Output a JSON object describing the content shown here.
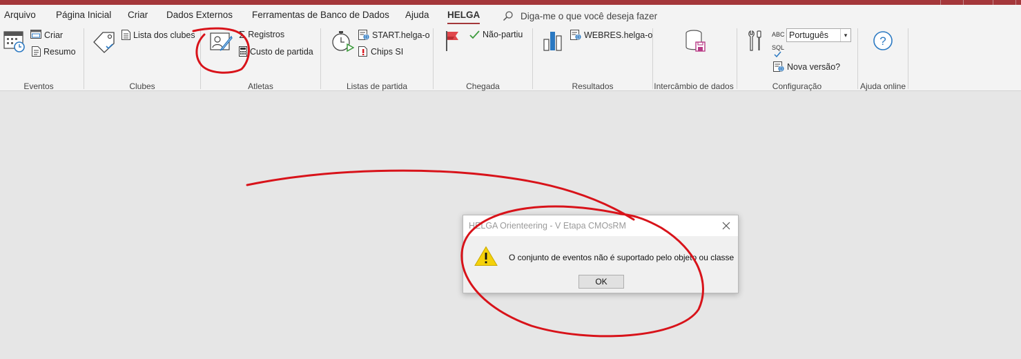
{
  "tabs": {
    "items": [
      "Arquivo",
      "Página Inicial",
      "Criar",
      "Dados Externos",
      "Ferramentas de Banco de Dados",
      "Ajuda",
      "HELGA"
    ],
    "active": "HELGA",
    "tell_me": "Diga-me o que você deseja fazer"
  },
  "ribbon": {
    "eventos": {
      "label": "Eventos",
      "criar": "Criar",
      "resumo": "Resumo"
    },
    "clubes": {
      "label": "Clubes",
      "lista": "Lista dos clubes"
    },
    "atletas": {
      "label": "Atletas",
      "registros": "Registros",
      "custo": "Custo de partida"
    },
    "listas": {
      "label": "Listas de partida",
      "start": "START.helga-o",
      "chips": "Chips SI"
    },
    "chegada": {
      "label": "Chegada",
      "nao_partiu": "Não-partiu"
    },
    "resultados": {
      "label": "Resultados",
      "webres": "WEBRES.helga-o"
    },
    "intercambio": {
      "label": "Intercâmbio de dados"
    },
    "configuracao": {
      "label": "Configuração",
      "language": "Português",
      "nova_versao": "Nova versão?",
      "abc": "ABC",
      "sql": "SQL"
    },
    "ajuda": {
      "label": "Ajuda online"
    }
  },
  "dialog": {
    "title": "HELGA Orienteering - V Etapa CMOsRM",
    "message": "O conjunto de eventos não é suportado pelo objeto ou classe",
    "ok": "OK"
  },
  "colors": {
    "accent": "#a4373a",
    "annotation": "#d8131a",
    "warning": "#f4d10b"
  }
}
